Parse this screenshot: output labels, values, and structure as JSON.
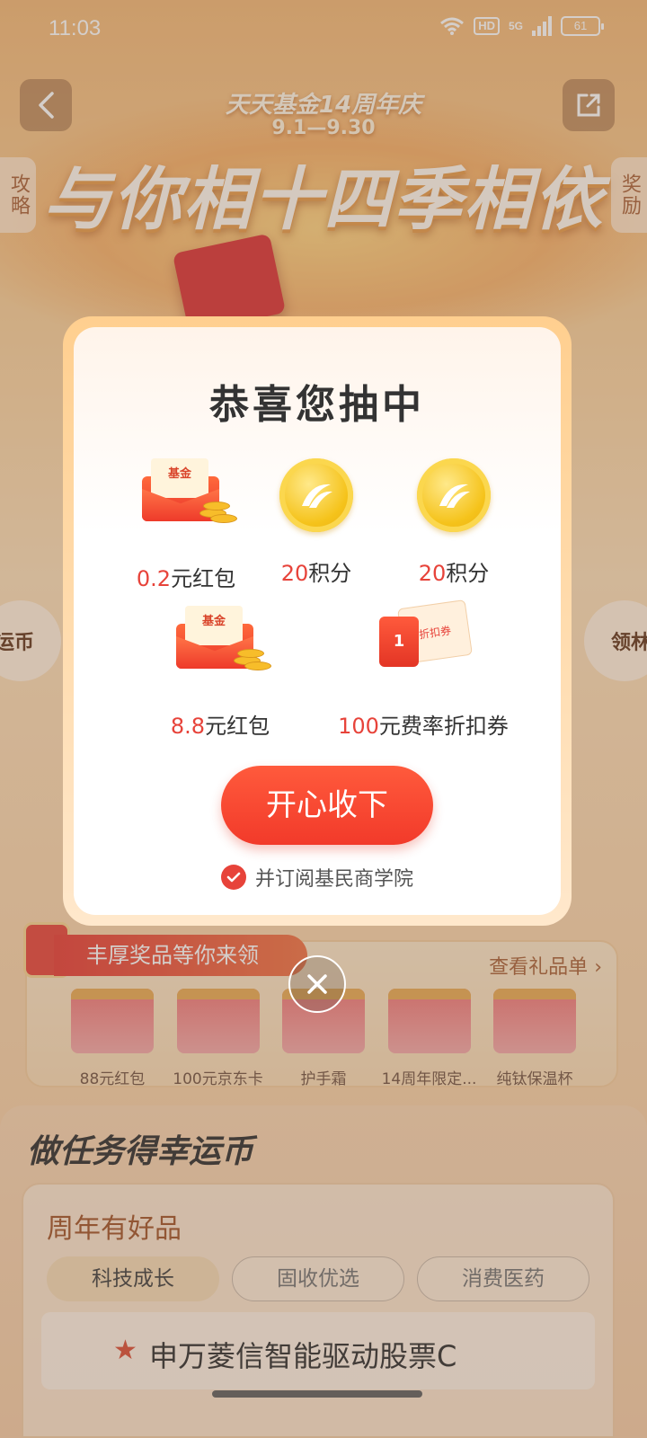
{
  "status_bar": {
    "time": "11:03",
    "hd_label": "HD",
    "network": "5G",
    "battery": "61"
  },
  "hero": {
    "subtitle": "天天基金14周年庆",
    "date_range": "9.1—9.30",
    "title": "与你相十四季相依"
  },
  "side_tabs": {
    "left": "攻略",
    "right": "奖励"
  },
  "side_circles": {
    "left": "运币",
    "right": "领林"
  },
  "modal": {
    "title": "恭喜您抽中",
    "rewards": [
      {
        "num": "0.2",
        "unit": "元红包",
        "icon": "red-envelope-icon"
      },
      {
        "num": "20",
        "unit": "积分",
        "icon": "coin-icon"
      },
      {
        "num": "20",
        "unit": "积分",
        "icon": "coin-icon"
      },
      {
        "num": "8.8",
        "unit": "元红包",
        "icon": "red-envelope-icon"
      },
      {
        "num": "100",
        "unit": "元费率折扣券",
        "icon": "coupon-icon"
      }
    ],
    "envelope_card_text": "基金",
    "coupon_front_text": "1",
    "coupon_back_text": "折扣券",
    "accept_button": "开心收下",
    "subscribe_text": "并订阅基民商学院",
    "subscribe_checked": true
  },
  "prize_strip": {
    "ribbon": "丰厚奖品等你来领",
    "view_list": "查看礼品单",
    "items": [
      "88元红包",
      "100元京东卡",
      "护手霜",
      "14周年限定...",
      "纯钛保温杯"
    ]
  },
  "task_section": {
    "title": "做任务得幸运币",
    "card_title": "周年有好品",
    "tabs": [
      {
        "label": "科技成长",
        "active": true
      },
      {
        "label": "固收优选",
        "active": false
      },
      {
        "label": "消费医药",
        "active": false
      }
    ],
    "fund_name": "申万菱信智能驱动股票C"
  },
  "colors": {
    "accent_red": "#e7433a",
    "button_red": "#f23a2a",
    "brand_orange": "#f2b46f"
  }
}
